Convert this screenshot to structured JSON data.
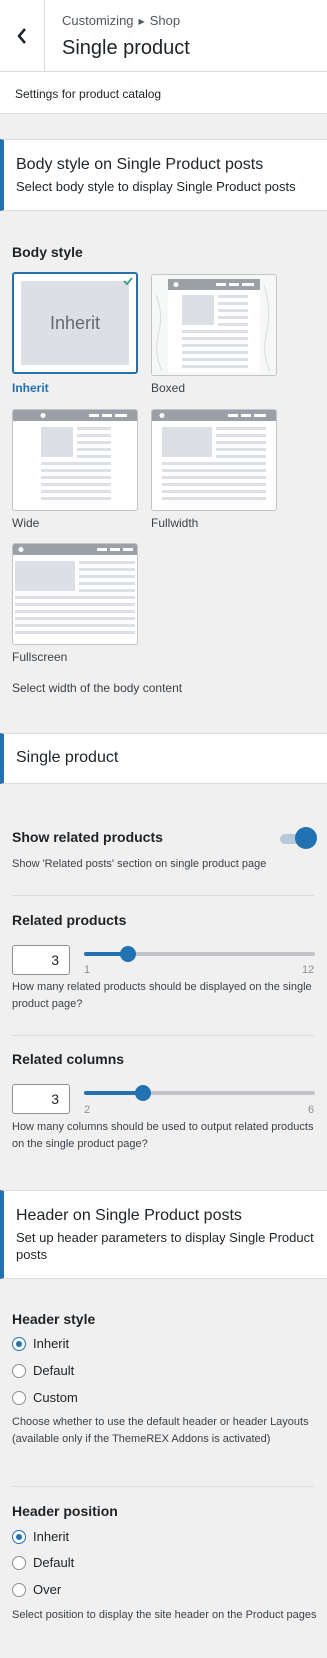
{
  "header": {
    "breadcrumb_parent": "Customizing",
    "breadcrumb_current": "Shop",
    "title": "Single product"
  },
  "panel_description": "Settings for product catalog",
  "body_section": {
    "title": "Body style on Single Product posts",
    "description": "Select body style to display Single Product posts",
    "label": "Body style",
    "options": [
      {
        "name": "Inherit",
        "thumb_text": "Inherit",
        "selected": true
      },
      {
        "name": "Boxed",
        "selected": false
      },
      {
        "name": "Wide",
        "selected": false
      },
      {
        "name": "Fullwidth",
        "selected": false
      },
      {
        "name": "Fullscreen",
        "selected": false
      }
    ],
    "help": "Select width of the body content"
  },
  "single_section": {
    "title": "Single product",
    "related_toggle": {
      "label": "Show related products",
      "help": "Show 'Related posts' section on single product page",
      "enabled": true
    },
    "related_products": {
      "label": "Related products",
      "value": "3",
      "min": "1",
      "max": "12",
      "help": "How many related products should be displayed on the single product page?"
    },
    "related_columns": {
      "label": "Related columns",
      "value": "3",
      "min": "2",
      "max": "6",
      "help": "How many columns should be used to output related products on the single product page?"
    }
  },
  "header_section": {
    "title": "Header on Single Product posts",
    "description": "Set up header parameters to display Single Product posts",
    "style": {
      "label": "Header style",
      "options": [
        "Inherit",
        "Default",
        "Custom"
      ],
      "selected": "Inherit",
      "help": "Choose whether to use the default header or header Layouts (available only if the ThemeREX Addons is activated)"
    },
    "position": {
      "label": "Header position",
      "options": [
        "Inherit",
        "Default",
        "Over"
      ],
      "selected": "Inherit",
      "help": "Select position to display the site header on the Product pages"
    }
  },
  "colors": {
    "accent": "#2271b1",
    "background": "#f0f0f1"
  }
}
